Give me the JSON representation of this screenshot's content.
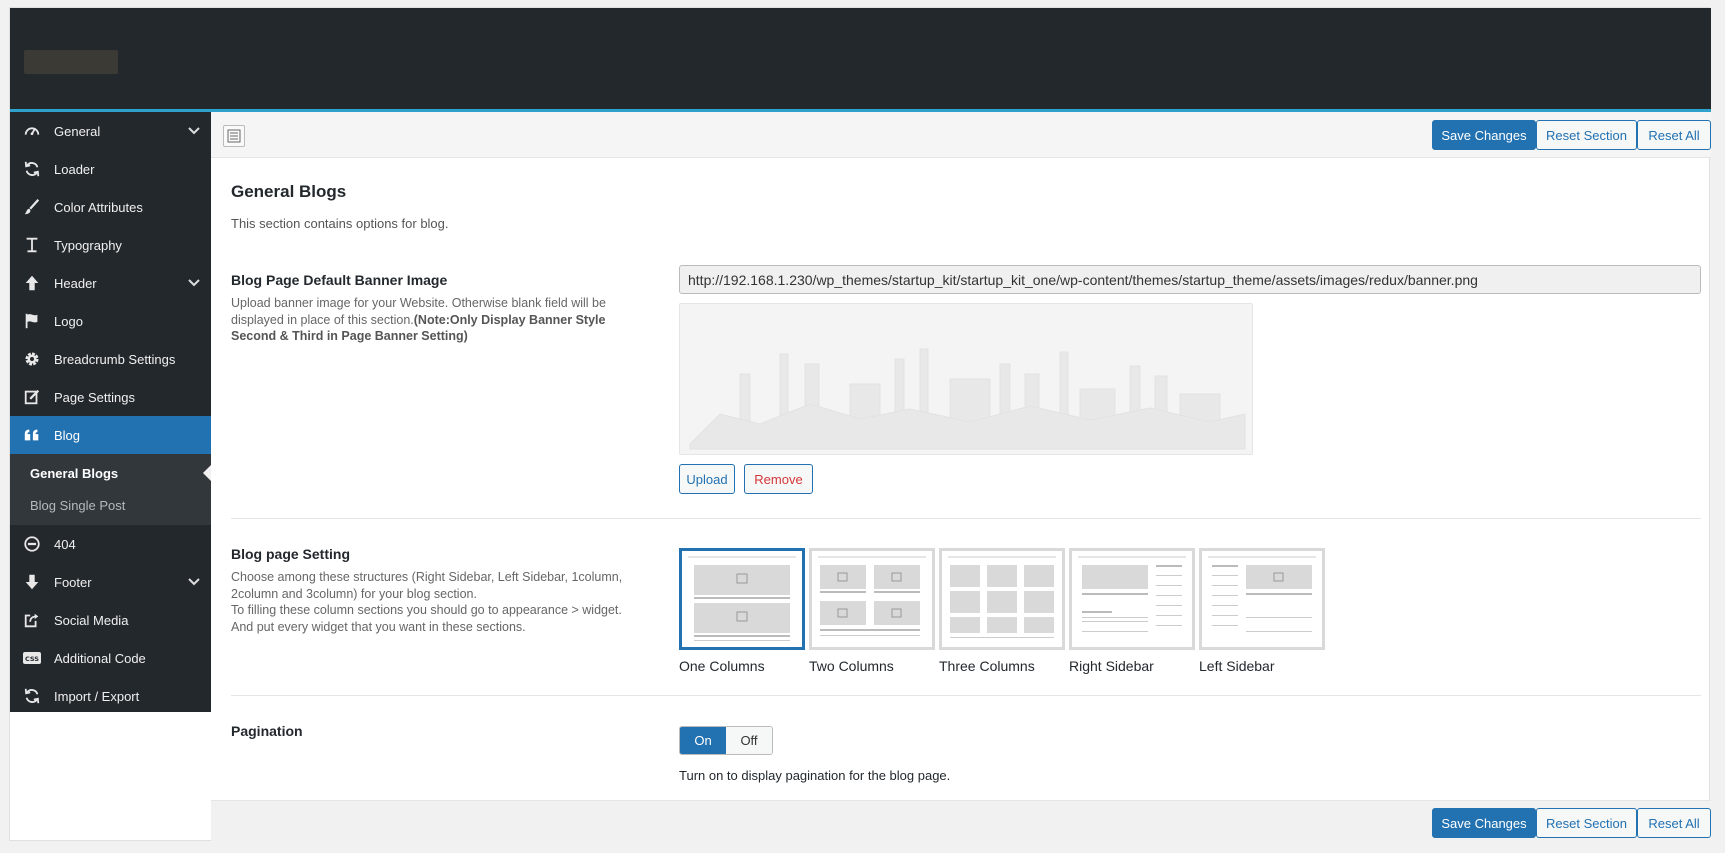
{
  "sidebar": {
    "items": [
      {
        "label": "General",
        "icon": "gauge-icon",
        "has_children": true
      },
      {
        "label": "Loader",
        "icon": "refresh-icon",
        "has_children": false
      },
      {
        "label": "Color Attributes",
        "icon": "brush-icon",
        "has_children": false
      },
      {
        "label": "Typography",
        "icon": "text-icon",
        "has_children": false
      },
      {
        "label": "Header",
        "icon": "arrow-up-icon",
        "has_children": true
      },
      {
        "label": "Logo",
        "icon": "flag-icon",
        "has_children": false
      },
      {
        "label": "Breadcrumb Settings",
        "icon": "gear-icon",
        "has_children": false
      },
      {
        "label": "Page Settings",
        "icon": "edit-icon",
        "has_children": false
      },
      {
        "label": "Blog",
        "icon": "quote-icon",
        "active": true
      },
      {
        "label": "404",
        "icon": "minus-circle-icon",
        "has_children": false
      },
      {
        "label": "Footer",
        "icon": "arrow-down-icon",
        "has_children": true
      },
      {
        "label": "Social Media",
        "icon": "share-icon",
        "has_children": false
      },
      {
        "label": "Additional Code",
        "icon": "css-icon",
        "has_children": false
      },
      {
        "label": "Import / Export",
        "icon": "refresh-icon",
        "has_children": false
      }
    ],
    "blog_sub": [
      {
        "label": "General Blogs",
        "current": true
      },
      {
        "label": "Blog Single Post",
        "current": false
      }
    ]
  },
  "toolbar": {
    "save_label": "Save Changes",
    "reset_section_label": "Reset Section",
    "reset_all_label": "Reset All"
  },
  "section": {
    "title": "General Blogs",
    "description": "This section contains options for blog."
  },
  "banner_field": {
    "title": "Blog Page Default Banner Image",
    "description": "Upload banner image for your Website. Otherwise blank field will be displayed in place of this section.",
    "note": "(Note:Only Display Banner Style Second & Third in Page Banner Setting)",
    "url_value": "http://192.168.1.230/wp_themes/startup_kit/startup_kit_one/wp-content/themes/startup_theme/assets/images/redux/banner.png",
    "upload_label": "Upload",
    "remove_label": "Remove"
  },
  "layout_field": {
    "title": "Blog page Setting",
    "description_1": "Choose among these structures (Right Sidebar, Left Sidebar, 1column, 2column and 3column) for your blog section.",
    "description_2": "To filling these column sections you should go to appearance > widget. And put every widget that you want in these sections.",
    "options": [
      {
        "label": "One Columns",
        "selected": true
      },
      {
        "label": "Two Columns",
        "selected": false
      },
      {
        "label": "Three Columns",
        "selected": false
      },
      {
        "label": "Right Sidebar",
        "selected": false
      },
      {
        "label": "Left Sidebar",
        "selected": false
      }
    ]
  },
  "pagination_field": {
    "title": "Pagination",
    "on_label": "On",
    "off_label": "Off",
    "value": "On",
    "description": "Turn on to display pagination for the blog page."
  },
  "colors": {
    "accent": "#2271b1",
    "sidebar_bg": "#23282d",
    "header_border": "#2ea2cc",
    "remove": "#d63638"
  }
}
